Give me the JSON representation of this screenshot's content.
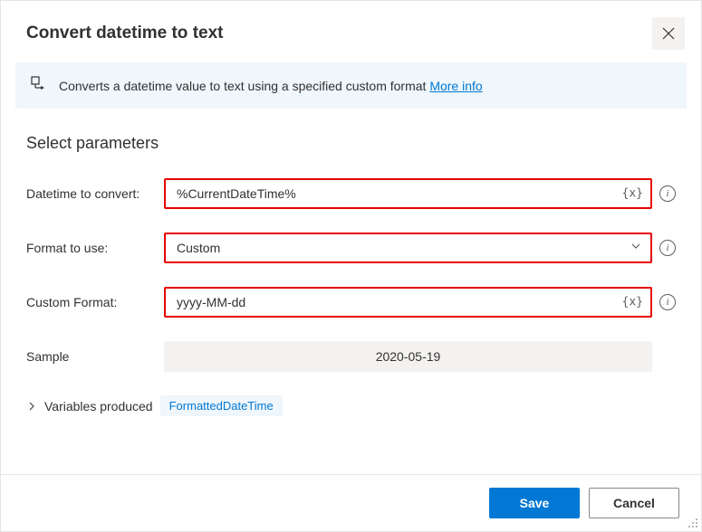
{
  "header": {
    "title": "Convert datetime to text"
  },
  "banner": {
    "text": "Converts a datetime value to text using a specified custom format ",
    "more_info": "More info"
  },
  "section": {
    "title": "Select parameters"
  },
  "fields": {
    "datetime_to_convert": {
      "label": "Datetime to convert:",
      "value": "%CurrentDateTime%"
    },
    "format_to_use": {
      "label": "Format to use:",
      "value": "Custom"
    },
    "custom_format": {
      "label": "Custom Format:",
      "value": "yyyy-MM-dd"
    },
    "sample": {
      "label": "Sample",
      "value": "2020-05-19"
    }
  },
  "variables": {
    "label": "Variables produced",
    "badge": "FormattedDateTime"
  },
  "glyphs": {
    "var_insert": "{x}"
  },
  "footer": {
    "save": "Save",
    "cancel": "Cancel"
  }
}
